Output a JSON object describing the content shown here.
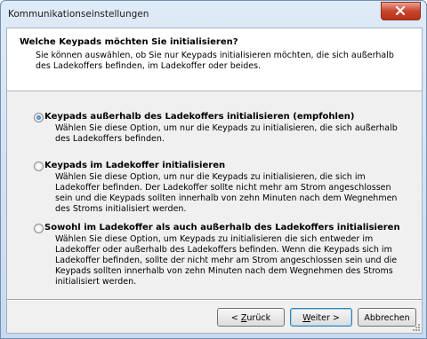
{
  "window": {
    "title": "Kommunikationseinstellungen"
  },
  "header": {
    "title": "Welche Keypads möchten Sie initialisieren?",
    "description": "Sie können auswählen, ob Sie nur Keypads initialisieren möchten, die sich außerhalb des Ladekoffers befinden, im Ladekoffer oder beides."
  },
  "options": [
    {
      "label": "Keypads außerhalb des Ladekoffers initialisieren (empfohlen)",
      "description": "Wählen Sie diese Option, um nur die Keypads zu initialisieren, die sich außerhalb des Ladekoffers befinden.",
      "selected": true
    },
    {
      "label": "Keypads im Ladekoffer initialisieren",
      "description": "Wählen Sie diese Option, um nur die Keypads zu initialisieren, die sich im Ladekoffer befinden. Der Ladekoffer sollte nicht mehr am Strom angeschlossen sein und die Keypads sollten innerhalb von zehn Minuten nach dem Wegnehmen des Stroms initialisiert werden.",
      "selected": false
    },
    {
      "label": "Sowohl im Ladekoffer als auch außerhalb des Ladekoffers initialisieren",
      "description": "Wählen Sie diese Option, um Keypads zu initialisieren die sich entweder im Ladekoffer oder außerhalb des Ladekoffers befinden. Wenn die Keypads sich im Ladekoffer befinden, sollte der nicht mehr am Strom angeschlossen sein und die Keypads sollten innerhalb von zehn Minuten nach dem Wegnehmen des Stroms initialisiert werden.",
      "selected": false
    }
  ],
  "buttons": {
    "back_prefix": "< ",
    "back_accel": "Z",
    "back_rest": "urück",
    "next_accel": "W",
    "next_rest": "eiter >",
    "cancel": "Abbrechen"
  }
}
